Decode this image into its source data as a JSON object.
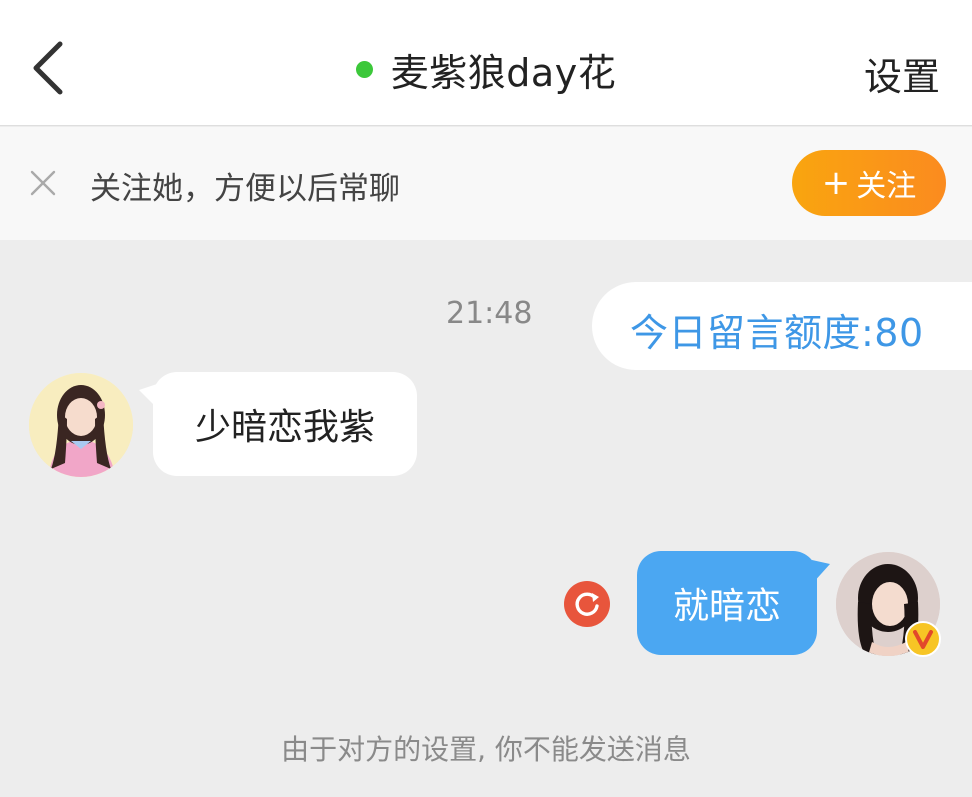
{
  "header": {
    "title": "麦紫狼day花",
    "settings_label": "设置",
    "online_color": "#3cc83a"
  },
  "follow_bar": {
    "text": "关注她，方便以后常聊",
    "button_plus": "+",
    "button_label": "关注",
    "button_color": "#fb8b1f"
  },
  "messages": [
    {
      "type": "system",
      "time": "21:48",
      "text": "今日留言额度:80"
    },
    {
      "type": "incoming",
      "text": "少暗恋我紫"
    },
    {
      "type": "outgoing",
      "text": "就暗恋",
      "status": "failed-resend-icon"
    }
  ],
  "footer": {
    "notice": "由于对方的设置, 你不能发送消息"
  },
  "icons": {
    "back": "chevron-left-icon",
    "close": "close-icon",
    "resend": "resend-icon",
    "vip": "vip-badge-icon"
  }
}
